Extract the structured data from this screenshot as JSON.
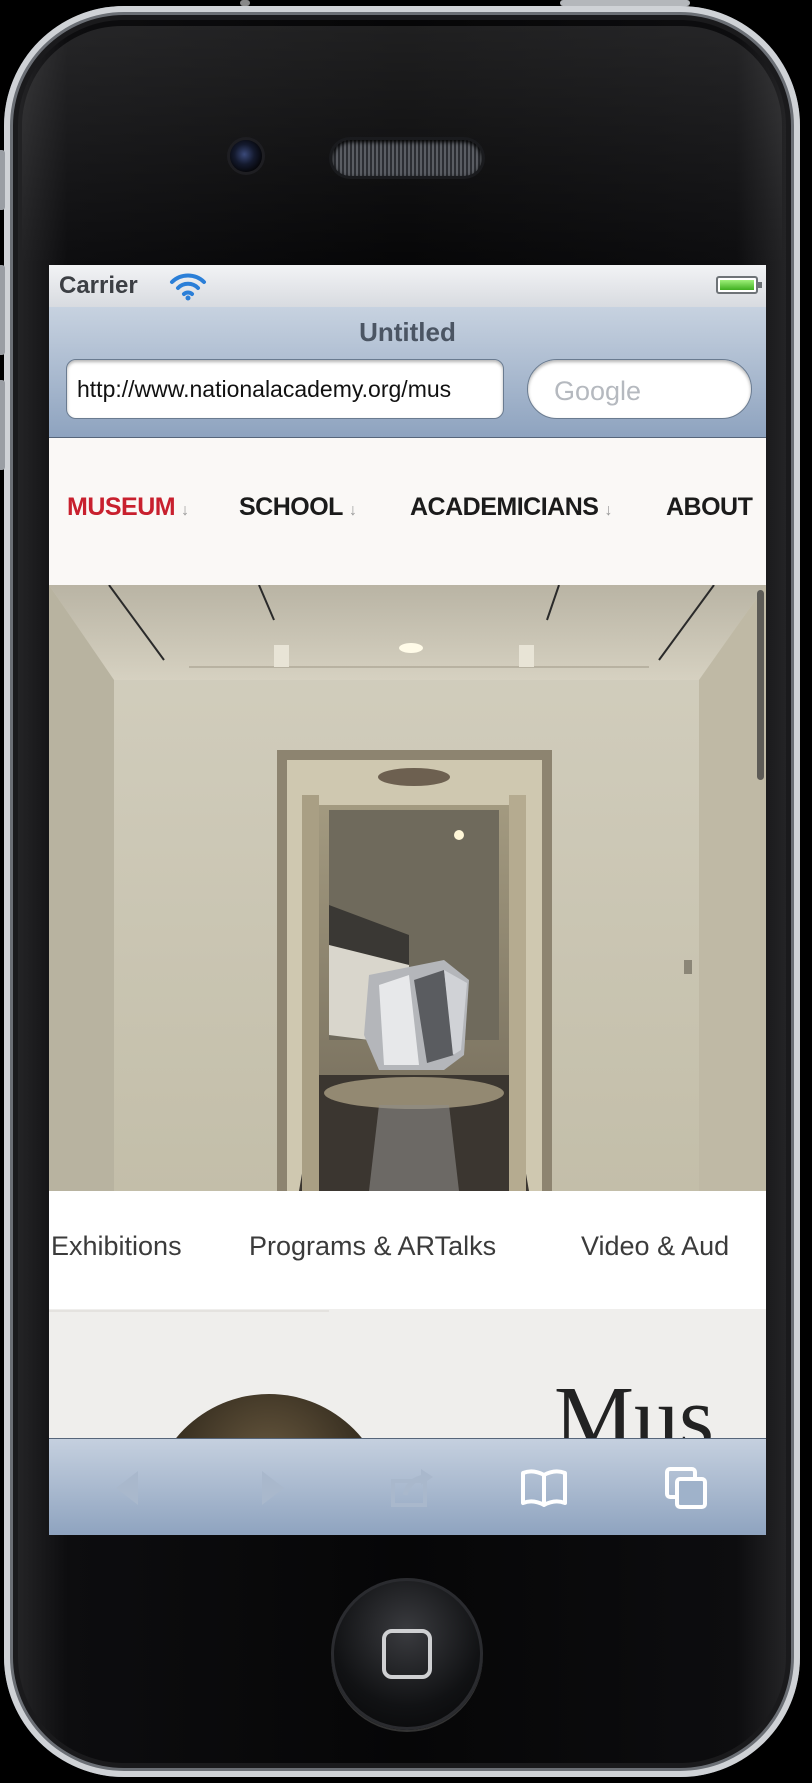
{
  "status_bar": {
    "carrier": "Carrier"
  },
  "browser": {
    "page_title": "Untitled",
    "url": "http://www.nationalacademy.org/mus",
    "search_placeholder": "Google"
  },
  "site_nav": {
    "items": [
      {
        "label": "MUSEUM",
        "active": true
      },
      {
        "label": "SCHOOL",
        "active": false
      },
      {
        "label": "ACADEMICIANS",
        "active": false
      },
      {
        "label": "ABOUT",
        "active": false
      }
    ]
  },
  "sub_nav": {
    "items": [
      "Exhibitions",
      "Programs & ARTalks",
      "Video & Aud"
    ]
  },
  "content": {
    "title_partial": "Mus"
  },
  "colors": {
    "active_nav": "#c8202e",
    "toolbar_top": "#c5d0df",
    "toolbar_bottom": "#8ea3bf"
  },
  "toolbar": {
    "buttons": [
      "back-icon",
      "forward-icon",
      "share-icon",
      "bookmarks-icon",
      "tabs-icon"
    ]
  }
}
